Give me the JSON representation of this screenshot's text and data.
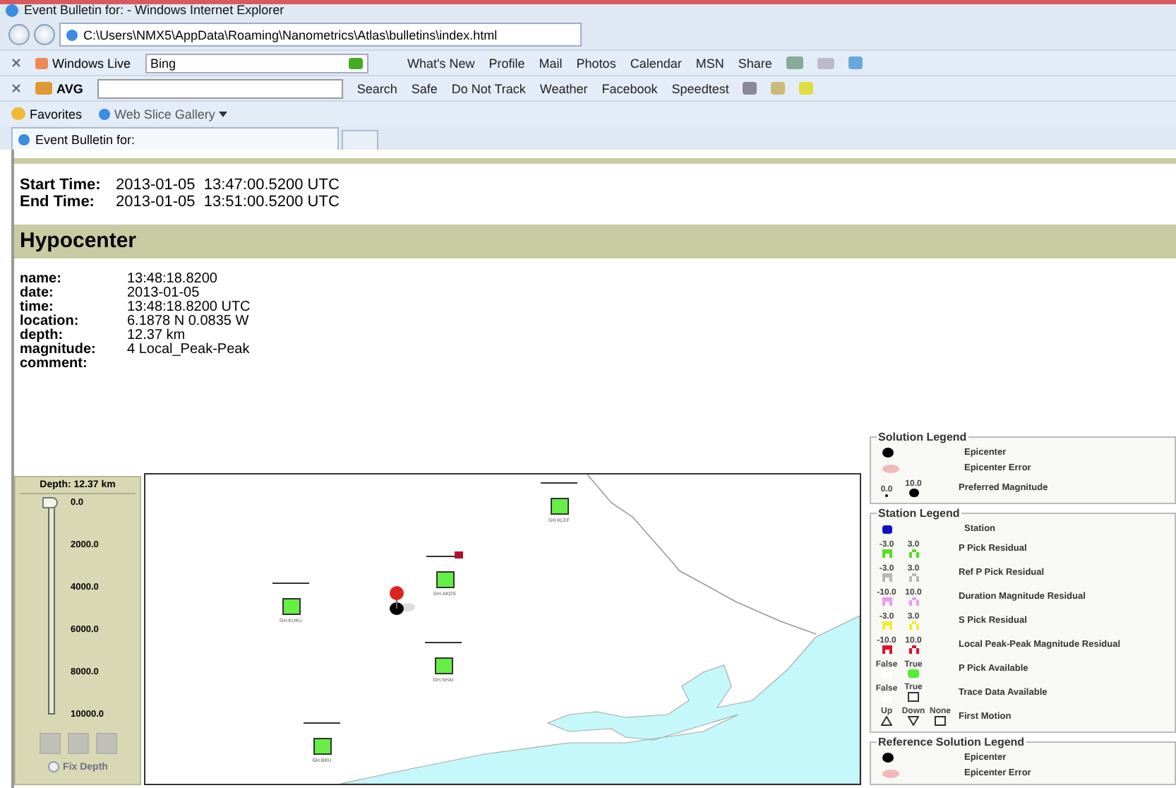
{
  "browser": {
    "title": "Event Bulletin for: - Windows Internet Explorer",
    "address": "C:\\Users\\NMX5\\AppData\\Roaming\\Nanometrics\\Atlas\\bulletins\\index.html",
    "live_bar": {
      "brand": "Windows Live",
      "search_value": "Bing",
      "links": [
        "What's New",
        "Profile",
        "Mail",
        "Photos",
        "Calendar",
        "MSN",
        "Share"
      ]
    },
    "avg_bar": {
      "brand": "AVG",
      "buttons": [
        "Search",
        "Safe",
        "Do Not Track",
        "Weather",
        "Facebook",
        "Speedtest"
      ]
    },
    "favorites_bar": {
      "label": "Favorites",
      "items": [
        "Web Slice Gallery"
      ]
    },
    "tabs": [
      {
        "label": "Event Bulletin for:",
        "selected": true
      }
    ]
  },
  "times": [
    {
      "label": "Start Time:",
      "value": "2013-01-05  13:47:00.5200 UTC"
    },
    {
      "label": "End Time:",
      "value": "2013-01-05  13:51:00.5200 UTC"
    }
  ],
  "hypocenter": {
    "title": "Hypocenter",
    "fields": [
      {
        "label": "name:",
        "value": "13:48:18.8200"
      },
      {
        "label": "date:",
        "value": "2013-01-05"
      },
      {
        "label": "time:",
        "value": "13:48:18.8200 UTC"
      },
      {
        "label": "location:",
        "value": "6.1878 N 0.0835 W"
      },
      {
        "label": "depth:",
        "value": "12.37 km"
      },
      {
        "label": "magnitude:",
        "value": "4 Local_Peak-Peak"
      },
      {
        "label": "comment:"
      }
    ]
  },
  "depth_slider": {
    "title": "Depth: 12.37 km",
    "level": 0.001,
    "ticks": [
      "0.0",
      "2000.0",
      "4000.0",
      "6000.0",
      "8000.0",
      "10000.0"
    ],
    "fix_depth": {
      "label": "Fix Depth",
      "checked": false
    }
  },
  "map": {
    "stations": [
      {
        "label": "GH.KLEF",
        "flagged": false
      },
      {
        "label": "GH.AKOS",
        "flagged": true
      },
      {
        "label": "GH.KUKU",
        "flagged": false
      },
      {
        "label": "GH.SHAI",
        "flagged": false
      },
      {
        "label": "GH.BRU",
        "flagged": false
      }
    ]
  },
  "solution_legend": {
    "title": "Solution Legend",
    "rows": [
      {
        "kind": "dot",
        "label": "Epicenter"
      },
      {
        "kind": "ellipse",
        "label": "Epicenter Error"
      },
      {
        "kind": "magnitude",
        "low": "0.0",
        "high": "10.0",
        "label": "Preferred Magnitude"
      }
    ]
  },
  "station_legend": {
    "title": "Station Legend",
    "rows": [
      {
        "kind": "station",
        "color": "#1010c0",
        "label": "Station"
      },
      {
        "kind": "residual",
        "low": "-3.0",
        "high": "3.0",
        "color": "#55dd22",
        "label": "P Pick Residual"
      },
      {
        "kind": "residual",
        "low": "-3.0",
        "high": "3.0",
        "color": "#b8b8b8",
        "label": "Ref P Pick Residual"
      },
      {
        "kind": "residual",
        "low": "-10.0",
        "high": "10.0",
        "color": "#ee99ee",
        "label": "Duration Magnitude Residual"
      },
      {
        "kind": "residual",
        "low": "-3.0",
        "high": "3.0",
        "color": "#eeee33",
        "label": "S Pick Residual"
      },
      {
        "kind": "residual",
        "low": "-10.0",
        "high": "10.0",
        "color": "#dd1030",
        "label": "Local Peak-Peak Magnitude Residual"
      },
      {
        "kind": "pick",
        "low": "False",
        "high": "True",
        "label": "P Pick Available"
      },
      {
        "kind": "trace",
        "low": "False",
        "high": "True",
        "label": "Trace Data Available"
      },
      {
        "kind": "motion",
        "options": [
          "Up",
          "Down",
          "None"
        ],
        "label": "First Motion"
      }
    ]
  },
  "reference_legend": {
    "title": "Reference Solution Legend",
    "rows": [
      {
        "kind": "dot",
        "label": "Epicenter"
      },
      {
        "kind": "ellipse",
        "label": "Epicenter Error"
      }
    ]
  }
}
